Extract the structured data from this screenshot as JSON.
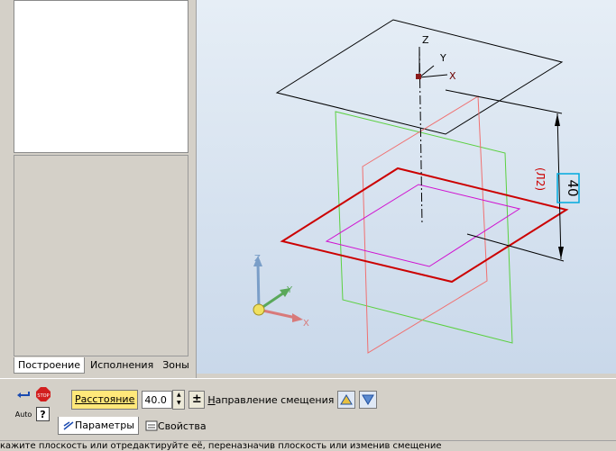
{
  "left_panel": {
    "tabs": [
      "Построение",
      "Исполнения",
      "Зоны"
    ]
  },
  "viewport": {
    "dimension_value": "40",
    "dimension_alt": "(Л2)",
    "local_axes": {
      "z": "Z",
      "y": "Y",
      "x": "X"
    },
    "triad_axes": {
      "z": "Z",
      "y": "Y",
      "x": "X"
    }
  },
  "toolbar": {
    "stop_label": "STOP",
    "auto_label": "Auto",
    "distance_label": "Расстояние",
    "distance_value": "40.0",
    "plus_minus": "±",
    "direction_label": "Направление смещения"
  },
  "bottom_tabs": [
    "Параметры",
    "Свойства"
  ],
  "status": {
    "text": "кажите плоскость или отредактируйте её, переназначив плоскость или изменив смещение"
  },
  "colors": {
    "selected_plane": "#cc0000",
    "base_plane": "#000000",
    "green_plane": "#33cc33",
    "pink_plane": "#ff6666",
    "magenta_plane": "#dd00dd",
    "dimension": "#000000"
  }
}
